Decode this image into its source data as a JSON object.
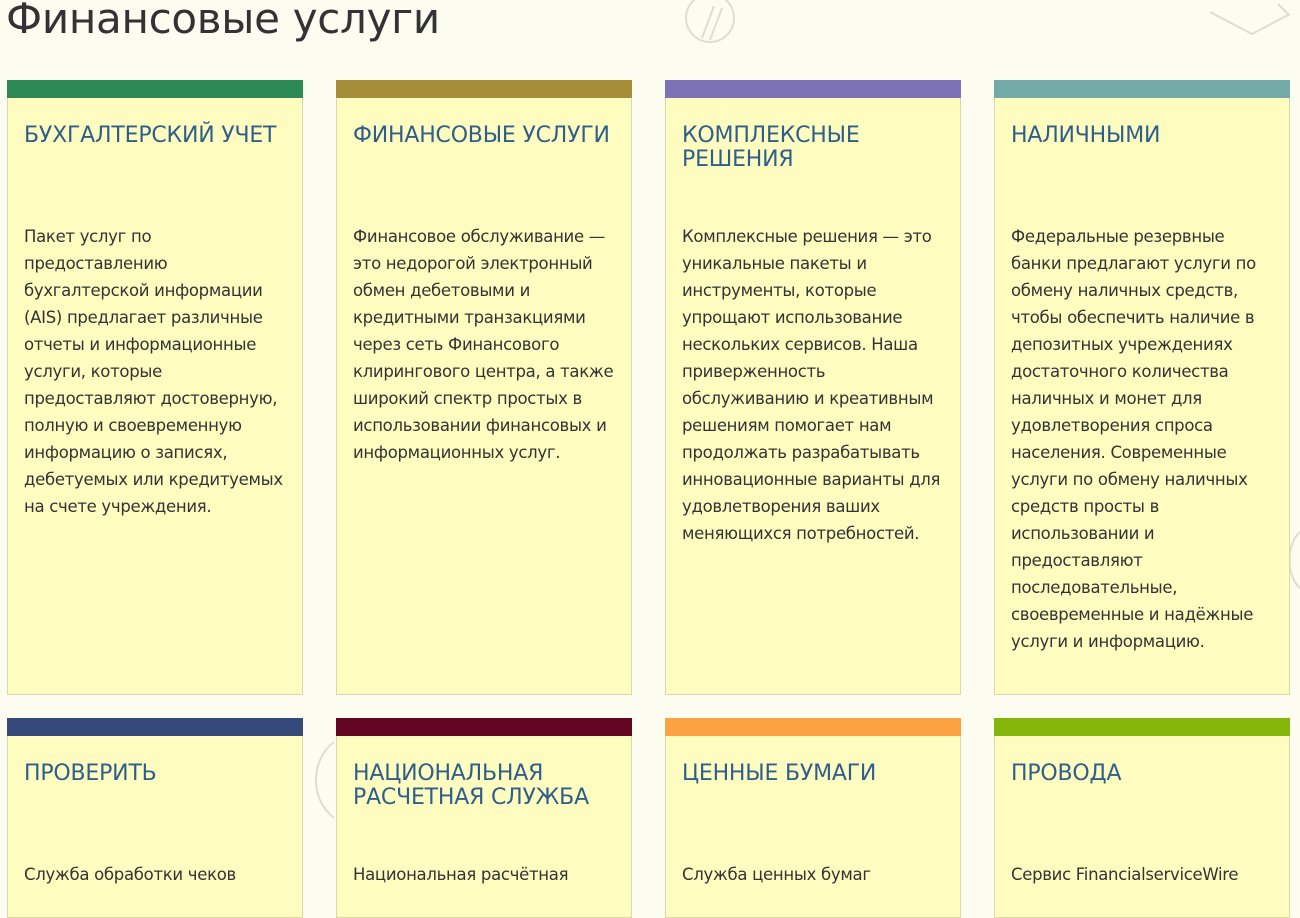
{
  "page": {
    "title": "Финансовые услуги"
  },
  "cards": [
    {
      "title": "БУХГАЛТЕРСКИЙ УЧЕТ",
      "text": "Пакет услуг по предоставлению бухгалтерской информации (AIS) предлагает различные отчеты и информационные услуги, которые предоставляют достоверную, полную и своевременную информацию о записях, дебетуемых или кредитуемых на счете учреждения.",
      "color": "#2d8a57"
    },
    {
      "title": "ФИНАНСОВЫЕ УСЛУГИ",
      "text": "Финансовое обслуживание — это недорогой электронный обмен дебетовыми и кредитными транзакциями через сеть Финансового клирингового центра, а также широкий спектр простых в использовании финансовых и информационных услуг.",
      "color": "#a58d39"
    },
    {
      "title": "КОМПЛЕКСНЫЕ РЕШЕНИЯ",
      "text": "Комплексные решения — это уникальные пакеты и инструменты, которые упрощают использование нескольких сервисов. Наша приверженность обслуживанию и креативным решениям помогает нам продолжать разрабатывать инновационные варианты для удовлетворения ваших меняющихся потребностей.",
      "color": "#7e72b6"
    },
    {
      "title": "НАЛИЧНЫМИ",
      "text": "Федеральные резервные банки предлагают услуги по обмену наличных средств, чтобы обеспечить наличие в депозитных учреждениях достаточного количества наличных и монет для удовлетворения спроса населения. Современные услуги по обмену наличных средств просты в использовании и предоставляют последовательные, своевременные и надёжные услуги и информацию.",
      "color": "#74aba9"
    },
    {
      "title": "ПРОВЕРИТЬ",
      "text": "Служба обработки чеков",
      "color": "#354a7a"
    },
    {
      "title": "НАЦИОНАЛЬНАЯ РАСЧЕТНАЯ СЛУЖБА",
      "text": "Национальная расчётная",
      "color": "#620521"
    },
    {
      "title": "ЦЕННЫЕ БУМАГИ",
      "text": "Служба ценных бумаг",
      "color": "#fba343"
    },
    {
      "title": "ПРОВОДА",
      "text": "Сервис FinancialserviceWire",
      "color": "#85b70a"
    }
  ]
}
